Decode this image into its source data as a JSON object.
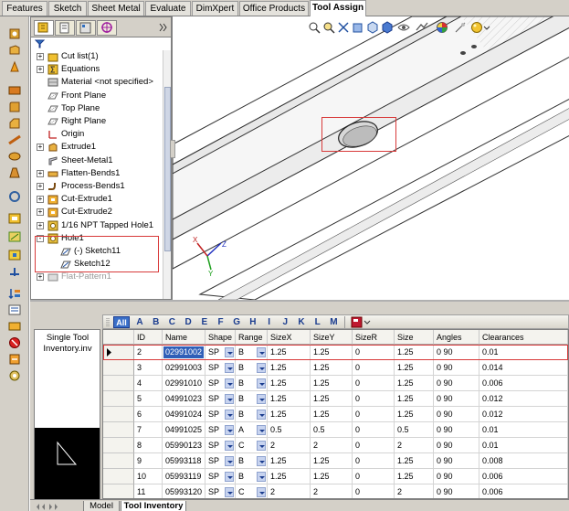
{
  "tabs": [
    "Features",
    "Sketch",
    "Sheet Metal",
    "Evaluate",
    "DimXpert",
    "Office Products",
    "Tool Assign"
  ],
  "active_tab": "Tool Assign",
  "feature_tree": [
    {
      "label": "Cut list(1)",
      "icon": "folder-icon",
      "expand": "+"
    },
    {
      "label": "Equations",
      "icon": "sigma-icon",
      "expand": "+"
    },
    {
      "label": "Material <not specified>",
      "icon": "material-icon",
      "expand": ""
    },
    {
      "label": "Front Plane",
      "icon": "plane-icon",
      "expand": ""
    },
    {
      "label": "Top Plane",
      "icon": "plane-icon",
      "expand": ""
    },
    {
      "label": "Right Plane",
      "icon": "plane-icon",
      "expand": ""
    },
    {
      "label": "Origin",
      "icon": "origin-icon",
      "expand": ""
    },
    {
      "label": "Extrude1",
      "icon": "extrude-icon",
      "expand": "+"
    },
    {
      "label": "Sheet-Metal1",
      "icon": "sheet-metal-icon",
      "expand": ""
    },
    {
      "label": "Flatten-Bends1",
      "icon": "flatten-bends-icon",
      "expand": "+"
    },
    {
      "label": "Process-Bends1",
      "icon": "process-bends-icon",
      "expand": "+"
    },
    {
      "label": "Cut-Extrude1",
      "icon": "cut-extrude-icon",
      "expand": "+"
    },
    {
      "label": "Cut-Extrude2",
      "icon": "cut-extrude-icon",
      "expand": "+"
    },
    {
      "label": "1/16 NPT Tapped Hole1",
      "icon": "hole-icon",
      "expand": "+"
    },
    {
      "label": "Hole1",
      "icon": "hole-icon",
      "expand": "-"
    },
    {
      "label": "(-) Sketch11",
      "icon": "sketch-icon",
      "expand": "",
      "indent": 1
    },
    {
      "label": "Sketch12",
      "icon": "sketch-icon",
      "expand": "",
      "indent": 1
    },
    {
      "label": "Flat-Pattern1",
      "icon": "flat-pattern-icon",
      "expand": "+",
      "dim": true
    }
  ],
  "inventory_title": "Single Tool Inventory.inv",
  "letters": [
    "All",
    "A",
    "B",
    "C",
    "D",
    "E",
    "F",
    "G",
    "H",
    "I",
    "J",
    "K",
    "L",
    "M"
  ],
  "columns": [
    "ID",
    "Name",
    "Shape",
    "Range",
    "SizeX",
    "SizeY",
    "SizeR",
    "Size",
    "Angles",
    "Clearances"
  ],
  "rows": [
    {
      "id": "2",
      "name": "02991002",
      "shape": "SP",
      "range": "B",
      "sizex": "1.25",
      "sizey": "1.25",
      "sizer": "0",
      "size": "1.25",
      "angles": "0 90",
      "clearances": "0.01"
    },
    {
      "id": "3",
      "name": "02991003",
      "shape": "SP",
      "range": "B",
      "sizex": "1.25",
      "sizey": "1.25",
      "sizer": "0",
      "size": "1.25",
      "angles": "0 90",
      "clearances": "0.014"
    },
    {
      "id": "4",
      "name": "02991010",
      "shape": "SP",
      "range": "B",
      "sizex": "1.25",
      "sizey": "1.25",
      "sizer": "0",
      "size": "1.25",
      "angles": "0 90",
      "clearances": "0.006"
    },
    {
      "id": "5",
      "name": "04991023",
      "shape": "SP",
      "range": "B",
      "sizex": "1.25",
      "sizey": "1.25",
      "sizer": "0",
      "size": "1.25",
      "angles": "0 90",
      "clearances": "0.012"
    },
    {
      "id": "6",
      "name": "04991024",
      "shape": "SP",
      "range": "B",
      "sizex": "1.25",
      "sizey": "1.25",
      "sizer": "0",
      "size": "1.25",
      "angles": "0 90",
      "clearances": "0.012"
    },
    {
      "id": "7",
      "name": "04991025",
      "shape": "SP",
      "range": "A",
      "sizex": "0.5",
      "sizey": "0.5",
      "sizer": "0",
      "size": "0.5",
      "angles": "0 90",
      "clearances": "0.01"
    },
    {
      "id": "8",
      "name": "05990123",
      "shape": "SP",
      "range": "C",
      "sizex": "2",
      "sizey": "2",
      "sizer": "0",
      "size": "2",
      "angles": "0 90",
      "clearances": "0.01"
    },
    {
      "id": "9",
      "name": "05993118",
      "shape": "SP",
      "range": "B",
      "sizex": "1.25",
      "sizey": "1.25",
      "sizer": "0",
      "size": "1.25",
      "angles": "0 90",
      "clearances": "0.008"
    },
    {
      "id": "10",
      "name": "05993119",
      "shape": "SP",
      "range": "B",
      "sizex": "1.25",
      "sizey": "1.25",
      "sizer": "0",
      "size": "1.25",
      "angles": "0 90",
      "clearances": "0.006"
    },
    {
      "id": "11",
      "name": "05993120",
      "shape": "SP",
      "range": "C",
      "sizex": "2",
      "sizey": "2",
      "sizer": "0",
      "size": "2",
      "angles": "0 90",
      "clearances": "0.006"
    }
  ],
  "selected_row_index": 0,
  "bottom_tabs": [
    "Model",
    "Tool Inventory"
  ],
  "active_bottom_tab": "Tool Inventory",
  "colors": {
    "highlight_border": "#d83a3a",
    "selected_name_bg": "#2f5fb8",
    "letter_text": "#1a3c8e"
  }
}
